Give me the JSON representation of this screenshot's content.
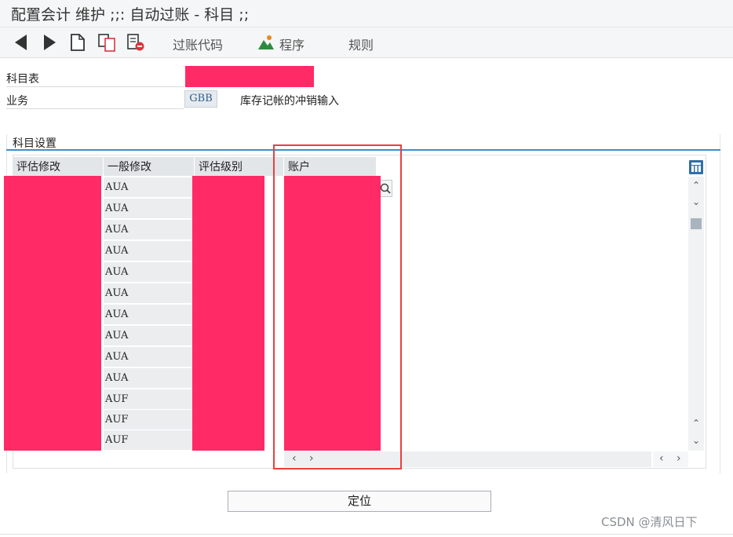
{
  "window": {
    "title": "配置会计 维护 ;;: 自动过账 - 科目 ;;"
  },
  "toolbar": {
    "icons": [
      "back-icon",
      "forward-icon",
      "new-document-icon",
      "copy-icon",
      "delete-icon"
    ],
    "posting_code_label": "过账代码",
    "program_label": "程序",
    "rules_label": "规则"
  },
  "header_fields": {
    "chart_of_accounts_label": "科目表",
    "transaction_label": "业务",
    "transaction_value": "GBB",
    "transaction_description": "库存记帐的冲销输入"
  },
  "section": {
    "title": "科目设置",
    "columns": [
      "评估修改",
      "一般修改",
      "评估级别",
      "账户"
    ],
    "general_modification_values": [
      "AUA",
      "AUA",
      "AUA",
      "AUA",
      "AUA",
      "AUA",
      "AUA",
      "AUA",
      "AUA",
      "AUA",
      "AUF",
      "AUF",
      "AUF"
    ]
  },
  "footer": {
    "locate_button": "定位",
    "watermark": "CSDN @清风日下"
  },
  "colors": {
    "accent": "#3c8fd0",
    "redaction": "#ff2a66",
    "highlight": "#e8403f"
  }
}
